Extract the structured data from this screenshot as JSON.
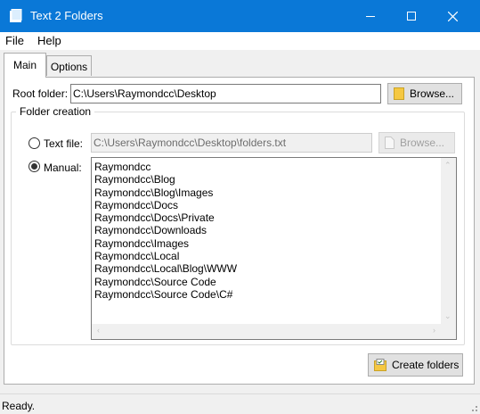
{
  "window": {
    "title": "Text 2 Folders",
    "icons": {
      "app": "folder-app-icon",
      "minimize": "minimize-icon",
      "maximize": "maximize-icon",
      "close": "close-icon"
    }
  },
  "menu": {
    "items": [
      "File",
      "Help"
    ]
  },
  "tabs": [
    {
      "label": "Main",
      "selected": true
    },
    {
      "label": "Options",
      "selected": false
    }
  ],
  "root": {
    "label": "Root folder:",
    "value": "C:\\Users\\Raymondcc\\Desktop",
    "browse_label": "Browse..."
  },
  "folder_creation": {
    "title": "Folder creation",
    "text_file": {
      "label": "Text file:",
      "value": "C:\\Users\\Raymondcc\\Desktop\\folders.txt",
      "browse_label": "Browse...",
      "selected": false,
      "enabled": false
    },
    "manual": {
      "label": "Manual:",
      "selected": true,
      "lines": [
        "Raymondcc",
        "Raymondcc\\Blog",
        "Raymondcc\\Blog\\Images",
        "Raymondcc\\Docs",
        "Raymondcc\\Docs\\Private",
        "Raymondcc\\Downloads",
        "Raymondcc\\Images",
        "Raymondcc\\Local",
        "Raymondcc\\Local\\Blog\\WWW",
        "Raymondcc\\Source Code",
        "Raymondcc\\Source Code\\C#"
      ]
    }
  },
  "actions": {
    "create_label": "Create folders"
  },
  "status": {
    "text": "Ready."
  },
  "colors": {
    "titlebar": "#0a78d7",
    "folder_yellow": "#f5c842",
    "window_bg": "#f0f0f0"
  }
}
